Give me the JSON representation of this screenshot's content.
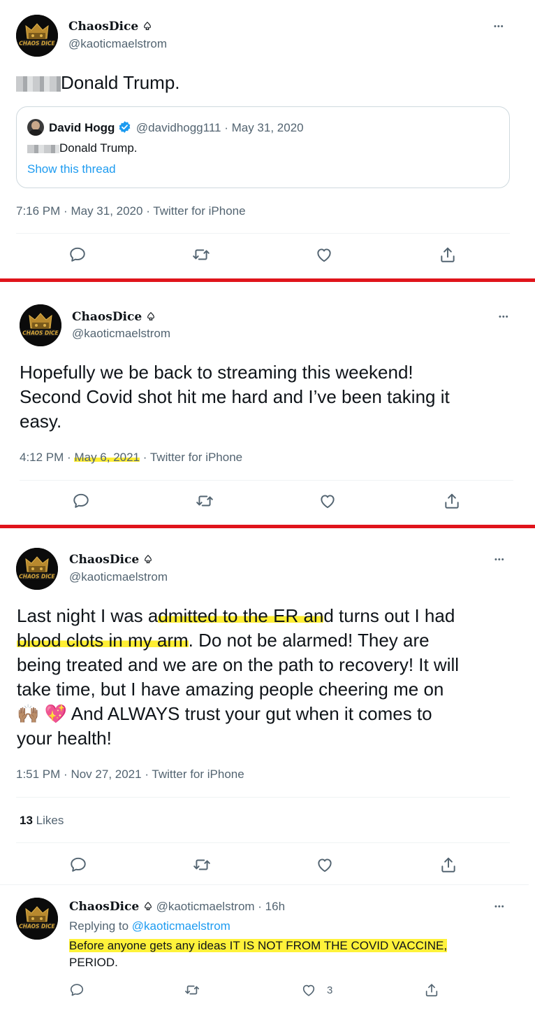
{
  "accent": "#1d9bf0",
  "highlight_color": "#ffee33",
  "separator_color": "#e0141b",
  "tweet1": {
    "name": "ChaosDice",
    "name_icon": "spade-outline-icon",
    "handle": "@kaoticmaelstrom",
    "text": "Donald Trump.",
    "quote": {
      "name": "David Hogg",
      "verified_icon": "verified-badge-icon",
      "handle_date": "@davidhogg111 · May 31, 2020",
      "text": "Donald Trump.",
      "show_thread": "Show this thread"
    },
    "time": "7:16 PM",
    "date": "May 31, 2020",
    "source": "Twitter for iPhone"
  },
  "tweet2": {
    "name": "ChaosDice",
    "handle": "@kaoticmaelstrom",
    "lines": [
      "Hopefully we be back to streaming this weekend!",
      "Second Covid shot hit me hard and I’ve been taking it",
      "easy."
    ],
    "time": "4:12 PM",
    "date": "May 6, 2021",
    "source": "Twitter for iPhone"
  },
  "tweet3": {
    "name": "ChaosDice",
    "handle": "@kaoticmaelstrom",
    "line1_a": "Last night I was a",
    "line1_hl": "dmitted to the ER an",
    "line1_b": "d turns out I had",
    "line2_hl": "blood clots in my arm",
    "line2_b": ". Do not be alarmed! They are",
    "line3": "being treated and we are on the path to recovery! It will",
    "line4": "take time, but I have amazing people cheering me on",
    "line5_emoji1": "🙌🏽",
    "line5_emoji2": "💖",
    "line5_text": "And ALWAYS trust your gut when it comes to",
    "line6": "your health!",
    "time": "1:51 PM",
    "date": "Nov 27, 2021",
    "source": "Twitter for iPhone",
    "likes_count": "13",
    "likes_label": "Likes"
  },
  "reply": {
    "name": "ChaosDice",
    "handle_time": "@kaoticmaelstrom · 16h",
    "replying_to_label": "Replying to",
    "replying_to_handle": "@kaoticmaelstrom",
    "text_hl": "Before anyone gets any ideas IT IS NOT FROM THE COVID VACCINE,",
    "text_2": "PERIOD.",
    "like_count": "3"
  },
  "icons": {
    "reply": "reply-bubble-icon",
    "retweet": "retweet-icon",
    "like": "heart-icon",
    "share": "share-icon",
    "more": "more-dots-icon"
  },
  "separator": "·",
  "more_glyph": "•••"
}
